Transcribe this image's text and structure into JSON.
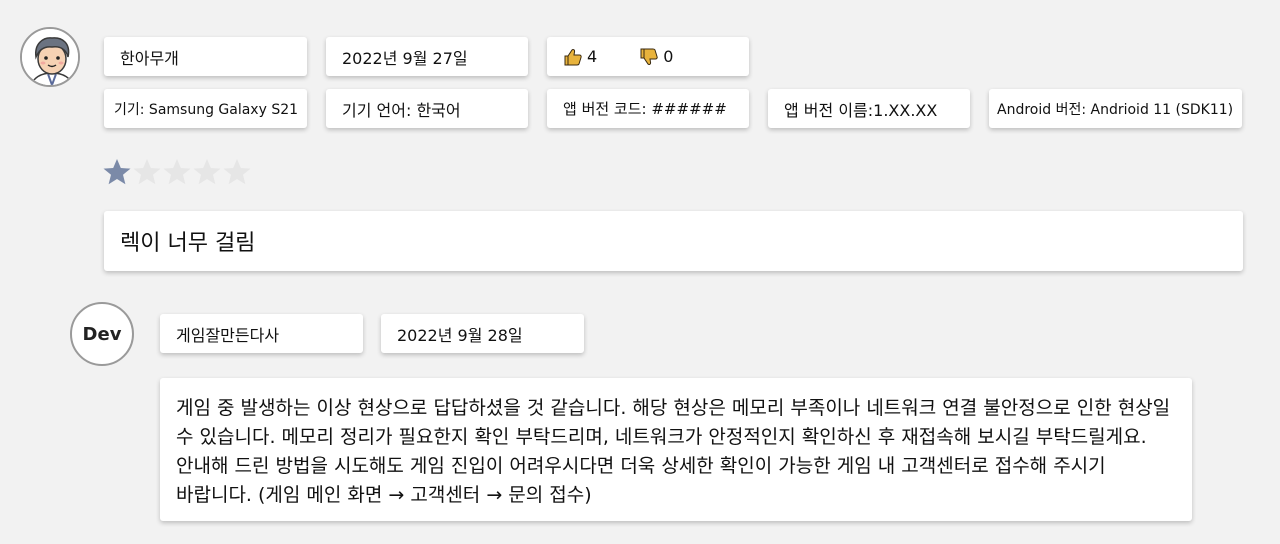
{
  "review": {
    "author": "한아무개",
    "date": "2022년 9월 27일",
    "thumbs_up_count": "4",
    "thumbs_down_count": "0",
    "device": "기기: Samsung Galaxy S21",
    "device_language": "기기 언어: 한국어",
    "app_version_code": "앱 버전 코드: ######",
    "app_version_name": "앱 버전 이름:1.XX.XX",
    "android_version": "Android 버전: Andrioid 11 (SDK11)",
    "rating": 1,
    "rating_max": 5,
    "text": "렉이 너무 걸림"
  },
  "reply": {
    "avatar_label": "Dev",
    "author": "게임잘만든다사",
    "date": "2022년 9월 28일",
    "text": "게임 중 발생하는 이상 현상으로 답답하셨을 것 같습니다. 해당 현상은 메모리 부족이나 네트워크 연결 불안정으로 인한 현상일 수 있습니다. 메모리 정리가 필요한지 확인 부탁드리며, 네트워크가 안정적인지 확인하신 후 재접속해 보시길 부탁드릴게요. 안내해 드린 방법을 시도해도 게임 진입이 어려우시다면 더욱 상세한 확인이 가능한 게임 내 고객센터로 접수해 주시기 바랍니다. (게임 메인 화면 → 고객센터 → 문의 접수)"
  },
  "colors": {
    "star_filled": "#7b8aa8",
    "star_empty": "#e6e6e6",
    "thumb": "#e8b33c"
  },
  "icons": {
    "thumbs_up": "thumbs-up-icon",
    "thumbs_down": "thumbs-down-icon"
  }
}
